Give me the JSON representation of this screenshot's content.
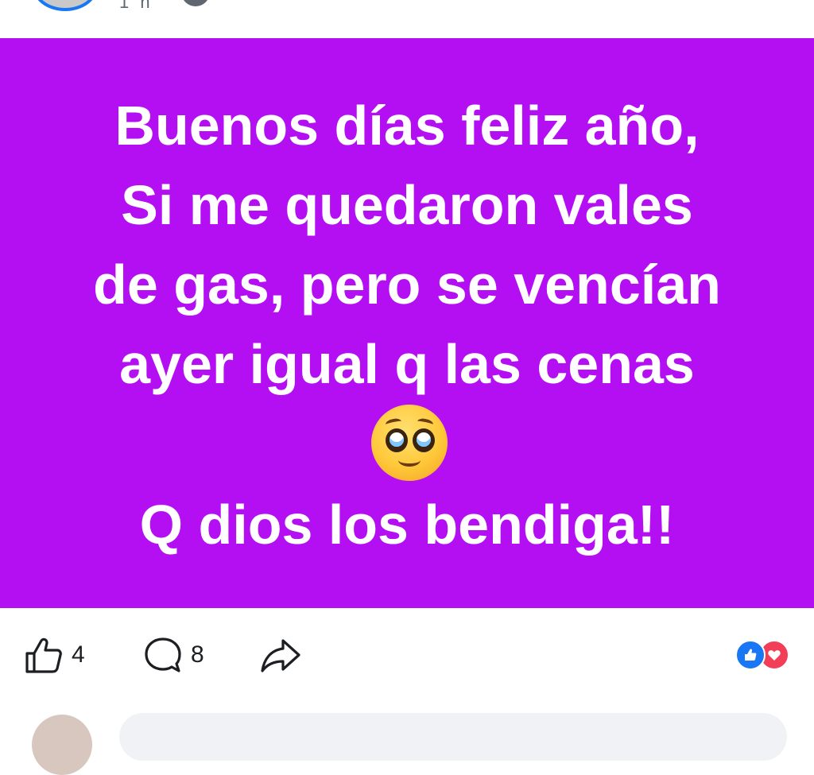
{
  "header": {
    "author_avatar": "avatar",
    "meta_text": "1 h",
    "privacy_icon": "globe-icon"
  },
  "post": {
    "background_color": "#b40ef2",
    "text_color": "#ffffff",
    "text_before_emoji": "Buenos días feliz año,\nSi me quedaron vales\nde gas, pero se vencían\nayer igual q las cenas",
    "emoji": "pleading-face-emoji",
    "text_after_emoji": "Q dios los bendiga!!"
  },
  "actions": {
    "like": {
      "icon": "thumbs-up-icon",
      "count": "4"
    },
    "comment": {
      "icon": "comment-bubble-icon",
      "count": "8"
    },
    "share": {
      "icon": "share-arrow-icon"
    }
  },
  "reactions": {
    "types": [
      "like",
      "love"
    ],
    "like_color": "#1877f2",
    "love_color": "#f33e58"
  },
  "comment_box": {
    "placeholder": ""
  }
}
